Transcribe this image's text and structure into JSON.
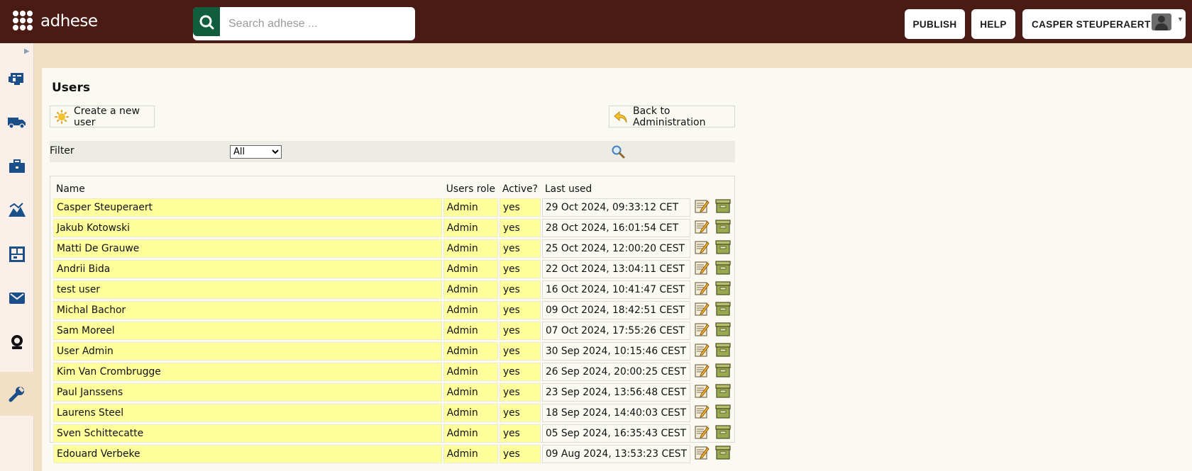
{
  "app": {
    "logo_text": "adhese",
    "search_placeholder": "Search adhese ...",
    "publish_label": "PUBLISH",
    "help_label": "HELP",
    "user_name": "CASPER STEUPERAERT"
  },
  "colors": {
    "topbar": "#4a1a15",
    "search_button": "#0f5d3c",
    "row_highlight": "#ffff9c",
    "sidebar_icon": "#1b4f8a"
  },
  "sidebar": {
    "items": [
      {
        "icon": "dashboard-icon"
      },
      {
        "icon": "truck-icon"
      },
      {
        "icon": "briefcase-icon"
      },
      {
        "icon": "chart-mountain-icon"
      },
      {
        "icon": "layout-icon"
      },
      {
        "icon": "mail-icon"
      },
      {
        "icon": "webcam-icon"
      },
      {
        "icon": "wrench-icon",
        "active": true
      }
    ]
  },
  "page": {
    "title": "Users",
    "create_label": "Create a new user",
    "back_label": "Back to Administration",
    "filter_label": "Filter",
    "filter_selected": "All"
  },
  "table": {
    "headers": [
      "Name",
      "Users role",
      "Active?",
      "Last used"
    ],
    "rows": [
      {
        "name": "Casper Steuperaert",
        "role": "Admin",
        "active": "yes",
        "last_used": "29 Oct 2024, 09:33:12 CET"
      },
      {
        "name": "Jakub Kotowski",
        "role": "Admin",
        "active": "yes",
        "last_used": "28 Oct 2024, 16:01:54 CET"
      },
      {
        "name": "Matti De Grauwe",
        "role": "Admin",
        "active": "yes",
        "last_used": "25 Oct 2024, 12:00:20 CEST"
      },
      {
        "name": "Andrii Bida",
        "role": "Admin",
        "active": "yes",
        "last_used": "22 Oct 2024, 13:04:11 CEST"
      },
      {
        "name": "test user",
        "role": "Admin",
        "active": "yes",
        "last_used": "16 Oct 2024, 10:41:47 CEST"
      },
      {
        "name": "Michal Bachor",
        "role": "Admin",
        "active": "yes",
        "last_used": "09 Oct 2024, 18:42:51 CEST"
      },
      {
        "name": "Sam Moreel",
        "role": "Admin",
        "active": "yes",
        "last_used": "07 Oct 2024, 17:55:26 CEST"
      },
      {
        "name": "User Admin",
        "role": "Admin",
        "active": "yes",
        "last_used": "30 Sep 2024, 10:15:46 CEST"
      },
      {
        "name": "Kim Van Crombrugge",
        "role": "Admin",
        "active": "yes",
        "last_used": "26 Sep 2024, 20:00:25 CEST"
      },
      {
        "name": "Paul Janssens",
        "role": "Admin",
        "active": "yes",
        "last_used": "23 Sep 2024, 13:56:48 CEST"
      },
      {
        "name": "Laurens Steel",
        "role": "Admin",
        "active": "yes",
        "last_used": "18 Sep 2024, 14:40:03 CEST"
      },
      {
        "name": "Sven Schittecatte",
        "role": "Admin",
        "active": "yes",
        "last_used": "05 Sep 2024, 16:35:43 CEST"
      },
      {
        "name": "Edouard Verbeke",
        "role": "Admin",
        "active": "yes",
        "last_used": "09 Aug 2024, 13:53:23 CEST"
      }
    ]
  }
}
